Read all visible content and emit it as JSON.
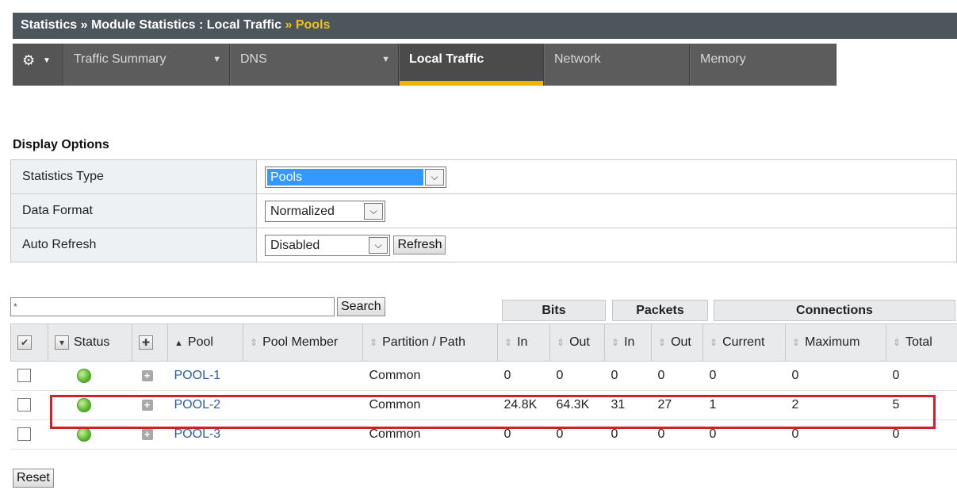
{
  "breadcrumb": {
    "part1": "Statistics",
    "sep": "»",
    "part2": "Module Statistics : Local Traffic",
    "current": "Pools"
  },
  "tabs": [
    {
      "label": "Traffic Summary",
      "has_menu": true
    },
    {
      "label": "DNS",
      "has_menu": true
    },
    {
      "label": "Local Traffic",
      "active": true
    },
    {
      "label": "Network"
    },
    {
      "label": "Memory"
    }
  ],
  "display_options": {
    "title": "Display Options",
    "statistics_type": {
      "label": "Statistics Type",
      "value": "Pools"
    },
    "data_format": {
      "label": "Data Format",
      "value": "Normalized"
    },
    "auto_refresh": {
      "label": "Auto Refresh",
      "value": "Disabled",
      "button": "Refresh"
    }
  },
  "filter": {
    "value": "*",
    "button": "Search"
  },
  "groups": {
    "bits": "Bits",
    "packets": "Packets",
    "connections": "Connections"
  },
  "columns": {
    "status": "Status",
    "pool": "Pool",
    "pool_member": "Pool Member",
    "partition": "Partition / Path",
    "bits_in": "In",
    "bits_out": "Out",
    "pkts_in": "In",
    "pkts_out": "Out",
    "current": "Current",
    "maximum": "Maximum",
    "total": "Total"
  },
  "rows": [
    {
      "pool": "POOL-1",
      "partition": "Common",
      "bits_in": "0",
      "bits_out": "0",
      "pkts_in": "0",
      "pkts_out": "0",
      "current": "0",
      "maximum": "0",
      "total": "0"
    },
    {
      "pool": "POOL-2",
      "partition": "Common",
      "bits_in": "24.8K",
      "bits_out": "64.3K",
      "pkts_in": "31",
      "pkts_out": "27",
      "current": "1",
      "maximum": "2",
      "total": "5"
    },
    {
      "pool": "POOL-3",
      "partition": "Common",
      "bits_in": "0",
      "bits_out": "0",
      "pkts_in": "0",
      "pkts_out": "0",
      "current": "0",
      "maximum": "0",
      "total": "0"
    }
  ],
  "reset_button": "Reset",
  "colors": {
    "accent": "#f0b400",
    "highlight": "#d0202a",
    "link": "#2a5da8",
    "status_ok": "#5cb82e"
  }
}
